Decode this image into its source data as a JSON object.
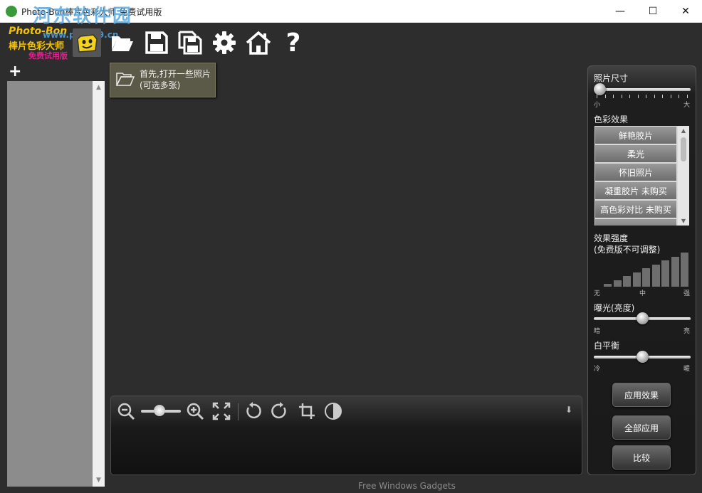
{
  "window": {
    "title": "Photo-Bon棒片色彩大师 免费试用版",
    "watermark": "河东软件园",
    "minimize": "—",
    "maximize": "☐",
    "close": "✕"
  },
  "logo": {
    "line1": "Photo-Bon",
    "line2": "棒片色彩大师",
    "line3": "免费试用版",
    "watermark_url": "www.pc0359.cn"
  },
  "toolbar": {
    "items": [
      "face-icon",
      "open-folder-icon",
      "save-icon",
      "save-all-icon",
      "gear-icon",
      "home-icon",
      "help-icon"
    ],
    "help_label": "?"
  },
  "tooltip": {
    "line1": "首先,打开一些照片",
    "line2": "(可选多张)"
  },
  "left_panel": {
    "add_label": "+",
    "scroll_up": "▲",
    "scroll_down": "▼"
  },
  "view_bar": {
    "zoom_level": 0.5,
    "download_label": "⬇"
  },
  "footer": "Free Windows Gadgets",
  "right_panel": {
    "size_label": "照片尺寸",
    "size_min": "小",
    "size_max": "大",
    "size_value": 0.0,
    "color_effects_label": "色彩效果",
    "effects": [
      "鲜艳胶片",
      "柔光",
      "怀旧照片",
      "凝重胶片 未购买",
      "高色彩对比 未购买"
    ],
    "effects_scroll_up": "▲",
    "effects_scroll_down": "▼",
    "strength_label_1": "效果强度",
    "strength_label_2": "(免费版不可调整)",
    "strength_min": "无",
    "strength_mid": "中",
    "strength_max": "强",
    "strength_levels": 9,
    "exposure_label": "曝光(亮度)",
    "exposure_min": "暗",
    "exposure_max": "亮",
    "exposure_value": 0.5,
    "wb_label": "白平衡",
    "wb_min": "冷",
    "wb_max": "暖",
    "wb_value": 0.5,
    "apply_button": "应用效果",
    "apply_all_button": "全部应用",
    "compare_button": "比较"
  }
}
